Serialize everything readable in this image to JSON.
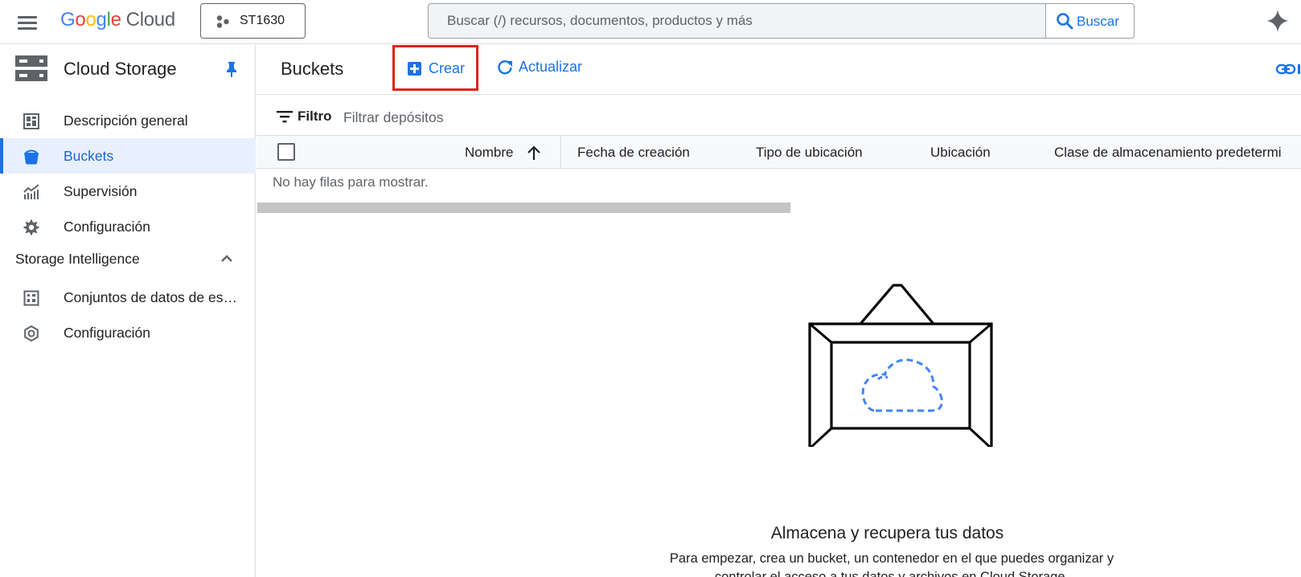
{
  "header": {
    "logo_letters": [
      "G",
      "o",
      "o",
      "g",
      "l",
      "e"
    ],
    "logo_product": "Cloud",
    "project_name": "ST1630",
    "search_placeholder": "Buscar (/) recursos, documentos, productos y más",
    "search_button_label": "Buscar"
  },
  "sidebar": {
    "product_title": "Cloud Storage",
    "items": [
      {
        "label": "Descripción general",
        "icon": "dashboard-icon",
        "active": false
      },
      {
        "label": "Buckets",
        "icon": "bucket-icon",
        "active": true
      },
      {
        "label": "Supervisión",
        "icon": "monitoring-chart-icon",
        "active": false
      },
      {
        "label": "Configuración",
        "icon": "gear-icon",
        "active": false
      }
    ],
    "section_title": "Storage Intelligence",
    "section_items": [
      {
        "label": "Conjuntos de datos de es…",
        "icon": "dataset-grid-icon"
      },
      {
        "label": "Configuración",
        "icon": "settings-outline-icon"
      }
    ]
  },
  "main": {
    "page_title": "Buckets",
    "create_label": "Crear",
    "refresh_label": "Actualizar",
    "filter_label": "Filtro",
    "filter_placeholder": "Filtrar depósitos",
    "columns": [
      "Nombre",
      "Fecha de creación",
      "Tipo de ubicación",
      "Ubicación",
      "Clase de almacenamiento predetermi"
    ],
    "empty_rows_text": "No hay filas para mostrar.",
    "empty_state_title": "Almacena y recupera tus datos",
    "empty_state_description": "Para empezar, crea un bucket, un contenedor en el que puedes organizar y controlar el acceso a tus datos y archivos en Cloud Storage."
  },
  "colors": {
    "accent": "#1a73e8",
    "active_bg": "#e8f0fe",
    "highlight_border": "#e3221c"
  }
}
